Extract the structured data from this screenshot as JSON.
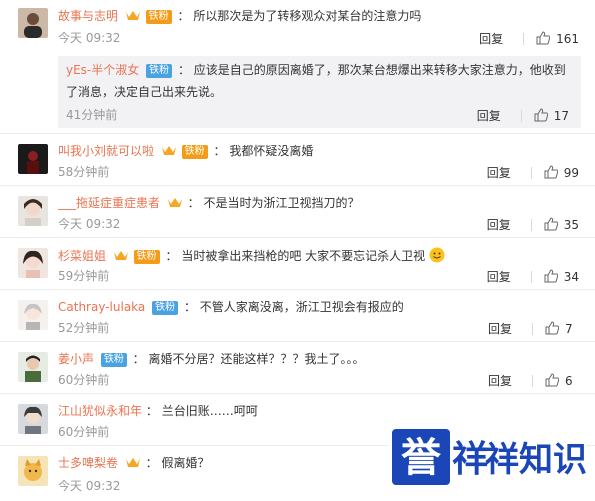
{
  "comments": [
    {
      "user": "故事与志明",
      "badge": "铁粉",
      "badge_color": "#f39c1a",
      "vip": true,
      "text": "所以那次是为了转移观众对某台的注意力吗",
      "time": "今天 09:32",
      "reply_label": "回复",
      "likes": "161",
      "sub_reply": {
        "user": "yEs-半个淑女",
        "badge": "铁粉",
        "badge_color": "#4aa3e0",
        "text_line1": "应该是自己的原因离婚了，那次某台想爆出来转移大家注意力，他收到",
        "text_line2": "了消息，决定自己出来先说。",
        "time": "41分钟前",
        "reply_label": "回复",
        "likes": "17"
      }
    },
    {
      "user": "叫我小刘就可以啦",
      "badge": "铁粉",
      "badge_color": "#f39c1a",
      "vip": true,
      "text": "我都怀疑没离婚",
      "time": "58分钟前",
      "reply_label": "回复",
      "likes": "99"
    },
    {
      "user": "___拖延症重症患者",
      "badge": "",
      "vip": true,
      "text": "不是当时为浙江卫视挡刀的？",
      "time": "今天 09:32",
      "reply_label": "回复",
      "likes": "35"
    },
    {
      "user": "杉菜姐姐",
      "badge": "铁粉",
      "badge_color": "#f39c1a",
      "vip": true,
      "text": "当时被拿出来挡枪的吧  大家不要忘记杀人卫视",
      "emoji": "slightly-smiling-emoji",
      "time": "59分钟前",
      "reply_label": "回复",
      "likes": "34"
    },
    {
      "user": "Cathray-lulaka",
      "badge": "铁粉",
      "badge_color": "#4aa3e0",
      "vip": false,
      "text": "不管人家离没离，浙江卫视会有报应的",
      "time": "52分钟前",
      "reply_label": "回复",
      "likes": "7"
    },
    {
      "user": "姜小声",
      "badge": "铁粉",
      "badge_color": "#4aa3e0",
      "vip": false,
      "text": "离婚不分居？还能这样？？？我土了。。。",
      "time": "60分钟前",
      "reply_label": "回复",
      "likes": "6"
    },
    {
      "user": "江山犹似永和年",
      "badge": "",
      "vip": false,
      "text": "兰台旧账……呵呵",
      "time": "60分钟前",
      "reply_label": "",
      "likes": ""
    },
    {
      "user": "士多啤梨卷",
      "badge": "",
      "vip": true,
      "text": "假离婚？",
      "time": "今天 09:32",
      "reply_label": "",
      "likes": ""
    }
  ],
  "watermark": {
    "logo_text": "誉",
    "brand_text": "祥",
    "name": "祥知识",
    "bg_color": "#1a46b8"
  },
  "colors": {
    "username": "#eb7350",
    "meta": "#999999",
    "sub_bg": "#f2f2f5"
  }
}
